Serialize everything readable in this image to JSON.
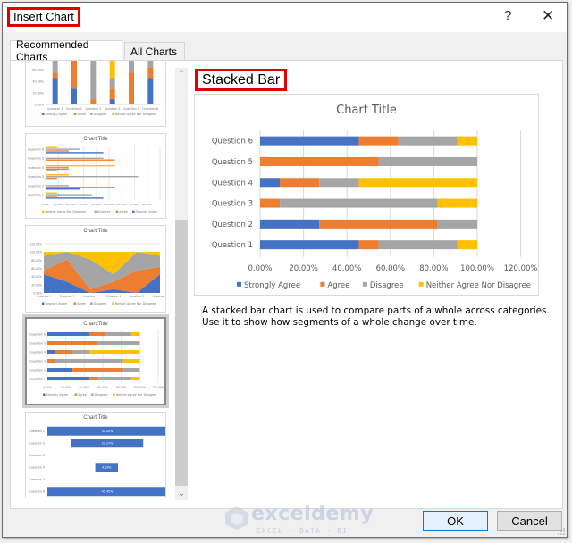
{
  "window": {
    "title": "Insert Chart",
    "help_label": "?",
    "close_label": "✕"
  },
  "tabs": [
    {
      "label": "Recommended Charts",
      "active": true
    },
    {
      "label": "All Charts",
      "active": false
    }
  ],
  "thumbnails": [
    {
      "name": "Stacked Column",
      "title": ""
    },
    {
      "name": "Clustered Bar",
      "title": "Chart Title"
    },
    {
      "name": "Stacked Area",
      "title": "Chart Title"
    },
    {
      "name": "Stacked Bar",
      "title": "Chart Title",
      "selected": true
    },
    {
      "name": "Funnel / Strongly Agree Bar",
      "title": "Chart Title",
      "data_labels": [
        "45.45%",
        "27.27%",
        "",
        "9.09%",
        "",
        "45.45%"
      ]
    }
  ],
  "scrollbar": {
    "up_icon": "⌃",
    "down_icon": "⌄"
  },
  "preview": {
    "heading": "Stacked Bar",
    "description_line1": "A stacked bar chart is used to compare parts of a whole across categories.",
    "description_line2": "Use it to show how segments of a whole change over time."
  },
  "chart_data": {
    "type": "bar",
    "orientation": "horizontal",
    "stacked": true,
    "title": "Chart Title",
    "xlabel": "",
    "ylabel": "",
    "categories": [
      "Question 1",
      "Question 2",
      "Question 3",
      "Question 4",
      "Question 5",
      "Question 6"
    ],
    "series": [
      {
        "name": "Strongly Agree",
        "color": "#4472c4",
        "values": [
          45.45,
          27.27,
          0,
          9.09,
          0,
          45.45
        ]
      },
      {
        "name": "Agree",
        "color": "#ed7d31",
        "values": [
          9.09,
          54.55,
          9.09,
          18.18,
          54.55,
          18.18
        ]
      },
      {
        "name": "Disagree",
        "color": "#a5a5a5",
        "values": [
          36.36,
          18.18,
          72.73,
          18.18,
          45.45,
          27.27
        ]
      },
      {
        "name": "Neither Agree Nor Disagree",
        "color": "#ffc000",
        "values": [
          9.09,
          0,
          18.18,
          54.55,
          0,
          9.09
        ]
      }
    ],
    "xlim": [
      0,
      120
    ],
    "x_ticks": [
      "0.00%",
      "20.00%",
      "40.00%",
      "60.00%",
      "80.00%",
      "100.00%",
      "120.00%"
    ],
    "grid": true,
    "legend_position": "bottom"
  },
  "buttons": {
    "ok": "OK",
    "cancel": "Cancel"
  },
  "watermark": {
    "brand": "exceldemy",
    "tagline": "EXCEL · DATA · BI"
  }
}
